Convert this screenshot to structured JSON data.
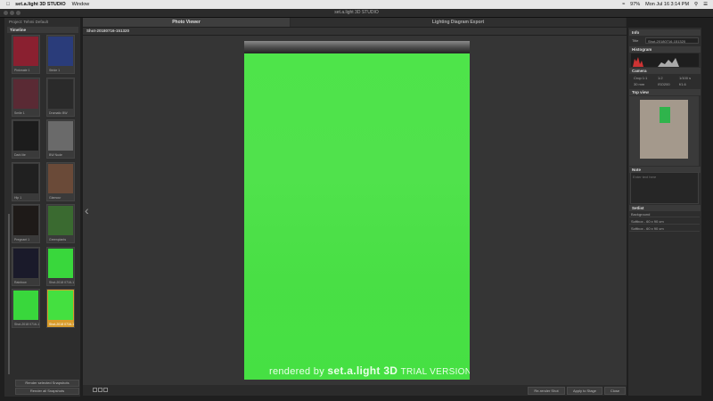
{
  "menubar": {
    "apple": "",
    "app_name": "set.a.light 3D STUDIO",
    "window_menu": "Window",
    "clock": "Mon Jul 16  3:14 PM",
    "battery": "97%"
  },
  "window": {
    "title": "set.a.light 3D STUDIO"
  },
  "sidebar": {
    "project_label": "Project: Tehmi Default",
    "timeline_title": "Timeline",
    "thumbs": [
      {
        "caption": "Pinkmate 1",
        "color": "#8a2030"
      },
      {
        "caption": "Stride 1",
        "color": "#2a3c7a"
      },
      {
        "caption": "Smile 1",
        "color": "#5a2a34"
      },
      {
        "caption": "Dramatic BW",
        "color": "#2a2a2a"
      },
      {
        "caption": "Dark lite",
        "color": "#1c1c1c"
      },
      {
        "caption": "BW Nude",
        "color": "#6a6a6a"
      },
      {
        "caption": "Hip 1",
        "color": "#202020"
      },
      {
        "caption": "Glamour",
        "color": "#6a4a38"
      },
      {
        "caption": "Pregnant 1",
        "color": "#1e1a18"
      },
      {
        "caption": "Greenplants",
        "color": "#3a6a30"
      },
      {
        "caption": "Rainbow",
        "color": "#1a1a2a"
      },
      {
        "caption": "Shot-2018 0716-140700",
        "color": "#39d73c"
      },
      {
        "caption": "Shot-2018 0716-150515",
        "color": "#39d73c"
      },
      {
        "caption": "Shot-2018 0716-151320",
        "color": "#44e040"
      }
    ],
    "render_selected_label": "Render selected Snapshots",
    "render_all_label": "Render all Snapshots"
  },
  "tabs": [
    {
      "label": "Photo Viewer"
    },
    {
      "label": "Lighting Diagram Export"
    }
  ],
  "viewer": {
    "shot_name": "Shot-20180716-151320",
    "prev_arrow": "‹",
    "watermark_rendered": "rendered by ",
    "watermark_brand": "set.a.light 3D",
    "watermark_trial": "TRIAL VERSION",
    "photo_color": "#4ee44a"
  },
  "bottom": {
    "rerender_label": "Re-render Shot",
    "apply_label": "Apply to Stage",
    "close_label": "Close"
  },
  "info": {
    "info_title": "Info",
    "title_label": "Title",
    "title_value": "Shot-20180716-151320",
    "histogram_title": "Histogram",
    "camera_title": "Camera",
    "camera": {
      "crop": "Crop 1:1",
      "ratio": "1:2",
      "shutter": "1/100 s",
      "focal": "30 mm",
      "iso": "ISO200",
      "aperture": "f/1.6"
    },
    "topview_title": "Top view",
    "note_title": "Note",
    "note_placeholder": "Enter text here",
    "setlist_title": "Setlist",
    "setlist": [
      {
        "label": "Background"
      },
      {
        "label": "Softbox - 60 x 90 cm"
      },
      {
        "label": "Softbox - 60 x 90 cm"
      }
    ]
  }
}
